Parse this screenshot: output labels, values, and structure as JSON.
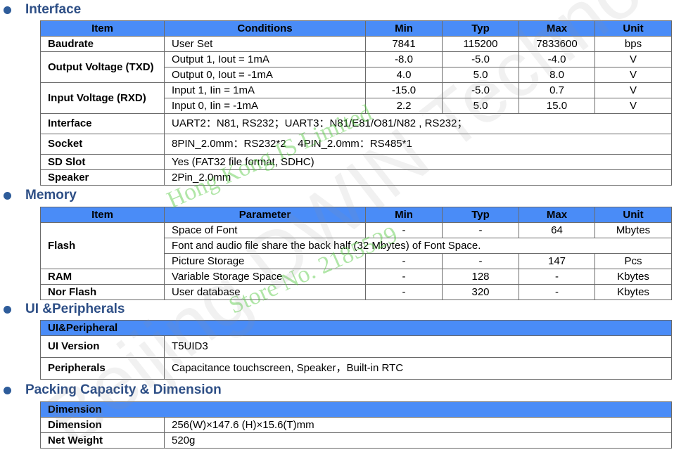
{
  "interface": {
    "title": "Interface",
    "headers": [
      "Item",
      "Conditions",
      "Min",
      "Typ",
      "Max",
      "Unit"
    ],
    "baudrate": {
      "item": "Baudrate",
      "cond": "User Set",
      "min": "7841",
      "typ": "115200",
      "max": "7833600",
      "unit": "bps"
    },
    "output_voltage": {
      "item": "Output Voltage (TXD)",
      "rows": [
        {
          "cond": "Output 1, Iout = 1mA",
          "min": "-8.0",
          "typ": "-5.0",
          "max": "-4.0",
          "unit": "V"
        },
        {
          "cond": "Output 0, Iout = -1mA",
          "min": "4.0",
          "typ": "5.0",
          "max": "8.0",
          "unit": "V"
        }
      ]
    },
    "input_voltage": {
      "item": "Input Voltage (RXD)",
      "rows": [
        {
          "cond": "Input 1, Iin = 1mA",
          "min": "-15.0",
          "typ": "-5.0",
          "max": "0.7",
          "unit": "V"
        },
        {
          "cond": "Input 0, Iin = -1mA",
          "min": "2.2",
          "typ": "5.0",
          "max": "15.0",
          "unit": "V"
        }
      ]
    },
    "interface_row": {
      "item": "Interface",
      "value": "UART2：N81, RS232；UART3：N81/E81/O81/N82 , RS232；"
    },
    "socket_row": {
      "item": "Socket",
      "value": "8PIN_2.0mm：RS232*2    4PIN_2.0mm：RS485*1"
    },
    "sdslot_row": {
      "item": "SD Slot",
      "value": "Yes (FAT32 file format, SDHC)"
    },
    "speaker_row": {
      "item": "Speaker",
      "value": "2Pin_2.0mm"
    }
  },
  "memory": {
    "title": "Memory",
    "headers": [
      "Item",
      "Parameter",
      "Min",
      "Typ",
      "Max",
      "Unit"
    ],
    "flash": {
      "item": "Flash",
      "font": {
        "param": "Space of Font",
        "min": "-",
        "typ": "-",
        "max": "64",
        "unit": "Mbytes"
      },
      "note": "Font and audio file share the back half (32 Mbytes) of Font Space.",
      "picture": {
        "param": "Picture Storage",
        "min": "-",
        "typ": "-",
        "max": "147",
        "unit": "Pcs"
      }
    },
    "ram": {
      "item": "RAM",
      "param": "Variable Storage Space",
      "min": "-",
      "typ": "128",
      "max": "-",
      "unit": "Kbytes"
    },
    "nor": {
      "item": "Nor Flash",
      "param": "User database",
      "min": "-",
      "typ": "320",
      "max": "-",
      "unit": "Kbytes"
    }
  },
  "ui": {
    "title": "UI &Peripherals",
    "header": "UI&Peripheral",
    "version": {
      "item": "UI Version",
      "value": "T5UID3"
    },
    "peripherals": {
      "item": "Peripherals",
      "value": "Capacitance touchscreen, Speaker，Built-in RTC"
    }
  },
  "packing": {
    "title": "Packing Capacity & Dimension",
    "header": "Dimension",
    "dimension": {
      "item": "Dimension",
      "value": "256(W)×147.6 (H)×15.6(T)mm"
    },
    "weight": {
      "item": "Net Weight",
      "value": "520g"
    }
  },
  "watermarks": {
    "line1": "Hong Kong  IS Limited",
    "line2": "Store  No.  2185529",
    "line3": "Beijing DWIN Technology"
  },
  "colors": {
    "header_bg": "#4a8cf7",
    "section_title": "#2e4f86",
    "bullet": "#2e5c9a"
  }
}
